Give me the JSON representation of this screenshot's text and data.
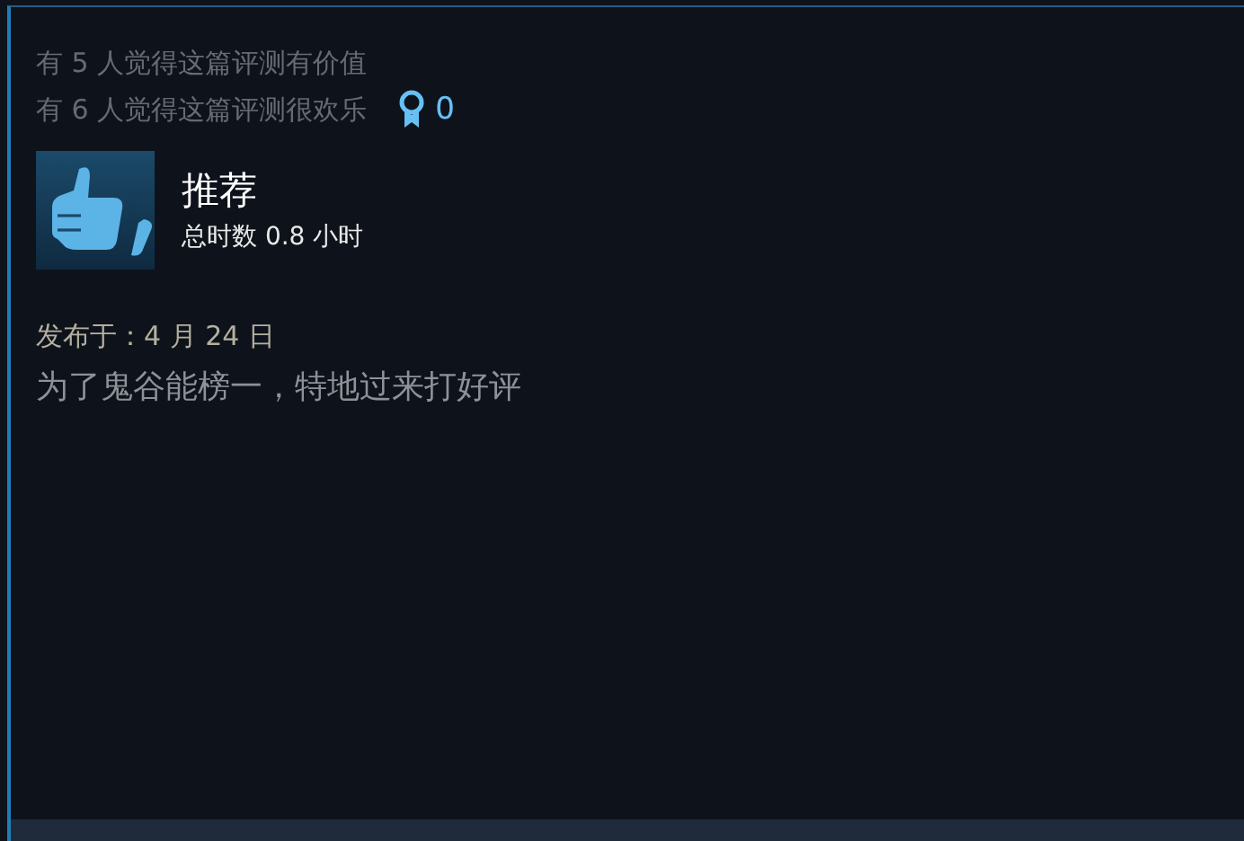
{
  "votes": [
    "有 5 人觉得这篇评测有价值",
    "有 6 人觉得这篇评测很欢乐"
  ],
  "awards": {
    "count": "0"
  },
  "review": {
    "kind": "recommended",
    "verdict": "推荐",
    "hours": "总时数 0.8 小时",
    "posted": "发布于：4 月 24 日",
    "text": "为了鬼谷能榜一，特地过来打好评"
  }
}
